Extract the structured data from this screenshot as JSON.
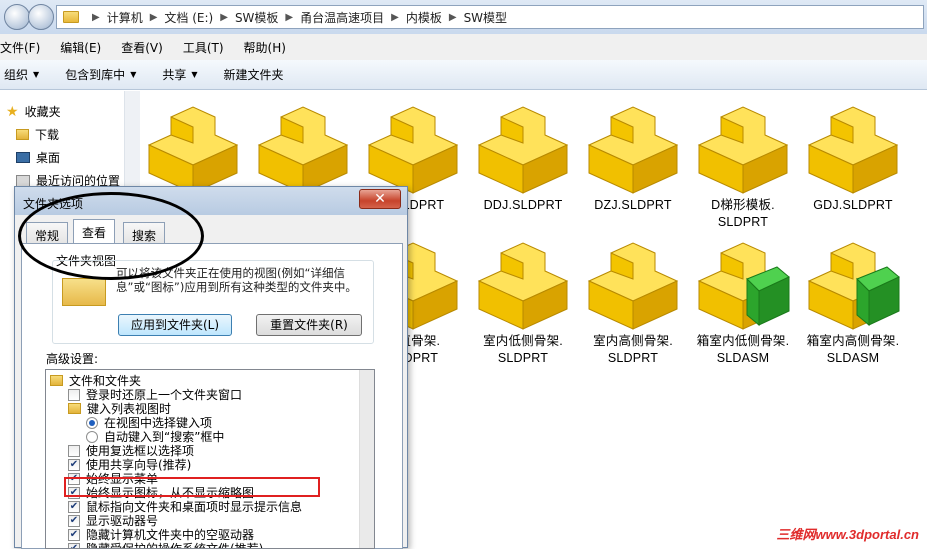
{
  "address": {
    "crumbs": [
      "计算机",
      "文档 (E:)",
      "SW模板",
      "甬台温高速项目",
      "内模板",
      "SW模型"
    ]
  },
  "menu": [
    "文件(F)",
    "编辑(E)",
    "查看(V)",
    "工具(T)",
    "帮助(H)"
  ],
  "toolbar": {
    "organize": "组织",
    "include_library": "包含到库中",
    "share": "共享",
    "new_folder": "新建文件夹"
  },
  "nav": {
    "favorites": "收藏夹",
    "downloads": "下载",
    "desktop": "桌面",
    "recent": "最近访问的位置"
  },
  "files": {
    "row1": [
      "B.SLDPRT",
      "DDJ.SLDPRT",
      "DZJ.SLDPRT",
      "D梯形模板.\nSLDPRT",
      "GDJ.SLDPRT"
    ],
    "row2": [
      "内直骨架.\nSLDPRT",
      "室内低侧骨架.\nSLDPRT",
      "室内高侧骨架.\nSLDPRT",
      "箱室内低侧骨架.\nSLDASM",
      "箱室内高侧骨架.\nSLDASM"
    ]
  },
  "dialog": {
    "title": "文件夹选项",
    "close": "✕",
    "tabs": [
      "常规",
      "查看",
      "搜索"
    ],
    "folder_view_label": "文件夹视图",
    "folder_view_desc": "可以将该文件夹正在使用的视图(例如“详细信息”或“图标”)应用到所有这种类型的文件夹中。",
    "apply_button": "应用到文件夹(L)",
    "reset_button": "重置文件夹(R)",
    "advanced_label": "高级设置:",
    "options": [
      {
        "type": "folder",
        "text": "文件和文件夹"
      },
      {
        "type": "check",
        "checked": false,
        "text": "登录时还原上一个文件夹窗口"
      },
      {
        "type": "folder",
        "text": "键入列表视图时"
      },
      {
        "type": "radio",
        "checked": true,
        "text": "在视图中选择键入项"
      },
      {
        "type": "radio",
        "checked": false,
        "text": "自动键入到“搜索”框中"
      },
      {
        "type": "check",
        "checked": false,
        "text": "使用复选框以选择项"
      },
      {
        "type": "check",
        "checked": true,
        "text": "使用共享向导(推荐)"
      },
      {
        "type": "check",
        "checked": true,
        "text": "始终显示菜单"
      },
      {
        "type": "check",
        "checked": true,
        "text": "始终显示图标，从不显示缩略图"
      },
      {
        "type": "check",
        "checked": true,
        "text": "鼠标指向文件夹和桌面项时显示提示信息"
      },
      {
        "type": "check",
        "checked": true,
        "text": "显示驱动器号"
      },
      {
        "type": "check",
        "checked": true,
        "text": "隐藏计算机文件夹中的空驱动器"
      },
      {
        "type": "check",
        "checked": true,
        "text": "隐藏受保护的操作系统文件(推荐)"
      }
    ]
  },
  "watermark": "三维网www.3dportal.cn",
  "colors": {
    "highlight": "#e02020",
    "folder_yellow": "#f5c400",
    "asm_green": "#2db52d"
  }
}
